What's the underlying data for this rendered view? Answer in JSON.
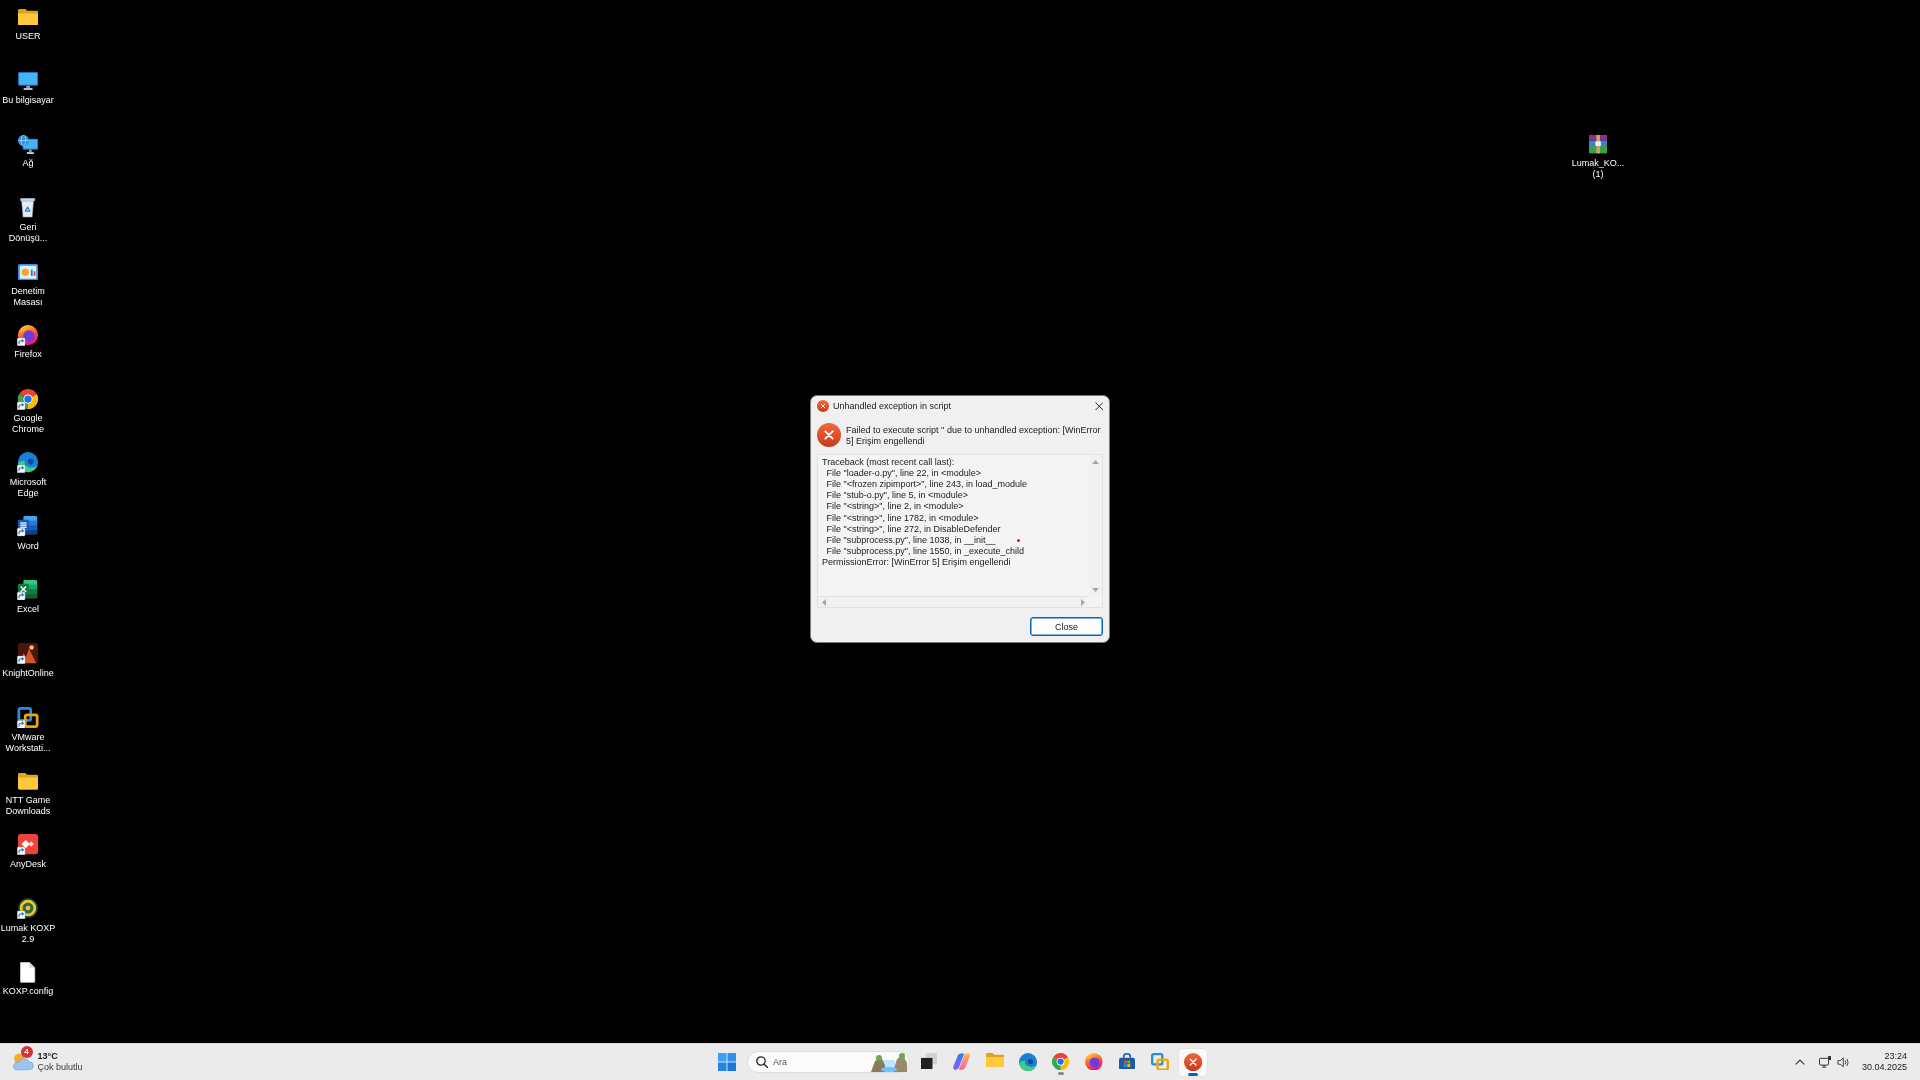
{
  "desktop": {
    "items": [
      {
        "label": "USER",
        "kind": "folder",
        "shortcut": false
      },
      {
        "label": "Bu bilgisayar",
        "kind": "pc",
        "shortcut": false
      },
      {
        "label": "Ağ",
        "kind": "network",
        "shortcut": false
      },
      {
        "label": "Geri Dönüşü...",
        "kind": "recycle-bin",
        "shortcut": false
      },
      {
        "label": "Denetim Masası",
        "kind": "control-panel",
        "shortcut": false
      },
      {
        "label": "Firefox",
        "kind": "firefox",
        "shortcut": true
      },
      {
        "label": "Google Chrome",
        "kind": "chrome",
        "shortcut": true
      },
      {
        "label": "Microsoft Edge",
        "kind": "edge",
        "shortcut": true
      },
      {
        "label": "Word",
        "kind": "word",
        "shortcut": true
      },
      {
        "label": "Excel",
        "kind": "excel",
        "shortcut": true
      },
      {
        "label": "KnightOnline",
        "kind": "game",
        "shortcut": true
      },
      {
        "label": "VMware Workstati...",
        "kind": "vmware",
        "shortcut": true
      },
      {
        "label": "NTT Game Downloads",
        "kind": "folder",
        "shortcut": false
      },
      {
        "label": "AnyDesk",
        "kind": "anydesk",
        "shortcut": true
      },
      {
        "label": "Lumak KOXP 2.9",
        "kind": "disc",
        "shortcut": true
      },
      {
        "label": "KOXP.config",
        "kind": "file",
        "shortcut": false
      }
    ],
    "corner_items": [
      {
        "label": "Lumak_KO... (1)",
        "kind": "archive",
        "shortcut": false
      }
    ]
  },
  "dialog": {
    "title": "Unhandled exception in script",
    "message": "Failed to execute script '' due to unhandled exception: [WinError 5] Erişim engellendi",
    "traceback": {
      "header": "Traceback (most recent call last):",
      "frames": [
        "File \"loader-o.py\", line 22, in <module>",
        "File \"<frozen zipimport>\", line 243, in load_module",
        "File \"stub-o.py\", line 5, in <module>",
        "File \"<string>\", line 2, in <module>",
        "File \"<string>\", line 1782, in <module>",
        "File \"<string>\", line 272, in DisableDefender",
        "File \"subprocess.py\", line 1038, in __init__",
        "File \"subprocess.py\", line 1550, in _execute_child"
      ],
      "error": "PermissionError: [WinError 5] Erişim engellendi"
    },
    "buttons": [
      {
        "label": "Close",
        "default": true
      }
    ]
  },
  "taskbar": {
    "weather": {
      "temperature": "13°C",
      "condition": "Çok bulutlu",
      "badge": "4"
    },
    "search": {
      "placeholder": "Ara"
    },
    "apps": [
      {
        "kind": "taskview",
        "running": false,
        "selected": false
      },
      {
        "kind": "copilot",
        "running": false,
        "selected": false
      },
      {
        "kind": "folder",
        "running": false,
        "selected": false
      },
      {
        "kind": "edge",
        "running": false,
        "selected": false
      },
      {
        "kind": "chrome",
        "running": true,
        "selected": false
      },
      {
        "kind": "firefox",
        "running": false,
        "selected": false
      },
      {
        "kind": "store",
        "running": false,
        "selected": false
      },
      {
        "kind": "vmware",
        "running": false,
        "selected": false
      },
      {
        "kind": "error",
        "running": true,
        "selected": true
      }
    ],
    "tray": {
      "time": "23:24",
      "date": "30.04.2025"
    }
  }
}
